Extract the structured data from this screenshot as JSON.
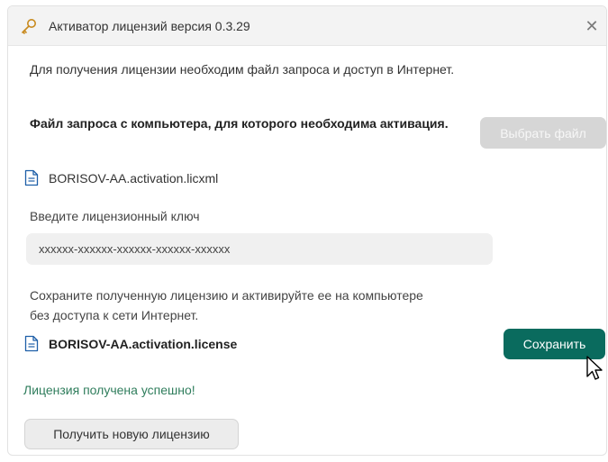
{
  "window": {
    "title": "Активатор лицензий версия 0.3.29",
    "title_icon": "key-icon",
    "close_glyph": "✕"
  },
  "intro_text": "Для получения лицензии необходим файл запроса и доступ в Интернет.",
  "request_section": {
    "heading": "Файл запроса с компьютера, для которого необходима активация.",
    "select_file_label": "Выбрать файл",
    "select_file_enabled": false,
    "file_icon": "document-icon",
    "file_name": "BORISOV-AA.activation.licxml"
  },
  "key_section": {
    "label": "Введите лицензионный ключ",
    "value": "xxxxxx-xxxxxx-xxxxxx-xxxxxx-xxxxxx"
  },
  "save_section": {
    "hint": "Сохраните полученную лицензию и активируйте ее на компьютере без доступа к сети Интернет.",
    "file_icon": "document-icon",
    "file_name": "BORISOV-AA.activation.license",
    "save_label": "Сохранить"
  },
  "status": {
    "success_text": "Лицензия получена успешно!"
  },
  "footer": {
    "new_license_label": "Получить новую лицензию"
  },
  "colors": {
    "accent": "#0a6b5e",
    "success_text": "#2f7d5c",
    "disabled_button": "#d6d6d6"
  }
}
